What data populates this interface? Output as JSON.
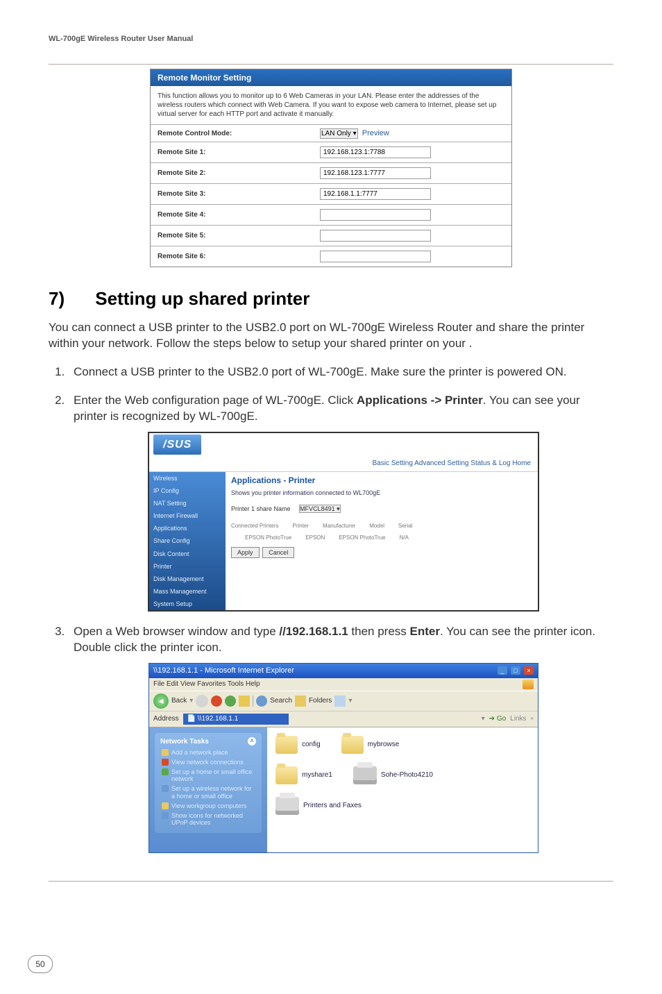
{
  "header": {
    "manual_title": "WL-700gE Wireless Router User Manual"
  },
  "remote_monitor": {
    "title": "Remote Monitor Setting",
    "description": "This function allows you to monitor up to 6 Web Cameras in your LAN. Please enter the addresses of the wireless routers which connect with Web Camera. If you want to expose web camera to Internet, please set up virtual server for each HTTP port and activate it manually.",
    "mode_label": "Remote Control Mode:",
    "mode_value": "LAN Only",
    "mode_preview": "Preview",
    "rows": [
      {
        "label": "Remote Site 1:",
        "value": "192.168.123.1:7788"
      },
      {
        "label": "Remote Site 2:",
        "value": "192.168.123.1:7777"
      },
      {
        "label": "Remote Site 3:",
        "value": "192.168.1.1:7777"
      },
      {
        "label": "Remote Site 4:",
        "value": ""
      },
      {
        "label": "Remote Site 5:",
        "value": ""
      },
      {
        "label": "Remote Site 6:",
        "value": ""
      }
    ]
  },
  "section": {
    "number": "7)",
    "title": "Setting up shared printer",
    "intro": "You can connect a USB printer to the USB2.0 port on WL-700gE Wireless Router and share the printer within your network. Follow the steps below to setup your shared printer on your .",
    "steps": [
      "Connect a USB printer to the USB2.0 port of WL-700gE. Make sure the printer is powered ON.",
      "Enter the Web configuration page of WL-700gE. Click Applications -> Printer. You can see your printer is recognized by WL-700gE.",
      "Open a Web browser window and type //192.168.1.1 then press Enter. You can see the printer icon. Double click the printer icon."
    ],
    "step2_bold_a": "Applications -> Printer",
    "step3_bold_a": "//192.168.1.1",
    "step3_bold_b": "Enter"
  },
  "asus": {
    "logo": "/SUS",
    "tabs": "Basic Setting   Advanced Setting   Status & Log   Home",
    "side": [
      "Wireless",
      "IP Config",
      "NAT Setting",
      "Internet Firewall",
      "Applications",
      "Share Config",
      "Disk Content",
      "Printer",
      "Disk Management",
      "Mass Management",
      "System Setup"
    ],
    "main_title": "Applications - Printer",
    "main_sub": "Shows you printer information connected to WL700gE",
    "row1_label": "Printer 1 share Name",
    "row1_value": "MFVCL8491",
    "row2_hdr": [
      "Connected Printers",
      "Printer",
      "Manufacturer",
      "Model",
      "Serial"
    ],
    "row2_vals": [
      "",
      "EPSON PhotoTrue",
      "EPSON",
      "EPSON PhotoTrue",
      "N/A"
    ],
    "btn_apply": "Apply",
    "btn_cancel": "Cancel"
  },
  "ie": {
    "title": "\\\\192.168.1.1 - Microsoft Internet Explorer",
    "menus": "File   Edit   View   Favorites   Tools   Help",
    "back": "Back",
    "toolbar_labels": [
      "Search",
      "Folders"
    ],
    "addr_label": "Address",
    "addr_value": "\\\\192.168.1.1",
    "go": "Go",
    "links": "Links",
    "side_title": "Network Tasks",
    "side_items": [
      "Add a network place",
      "View network connections",
      "Set up a home or small office network",
      "Set up a wireless network for a home or small office",
      "View workgroup computers",
      "Show icons for networked UPnP devices"
    ],
    "folders": [
      "config",
      "mybrowse",
      "myshare1",
      "Sohe-Photo4210",
      "Printers and Faxes"
    ]
  },
  "page_number": "50"
}
